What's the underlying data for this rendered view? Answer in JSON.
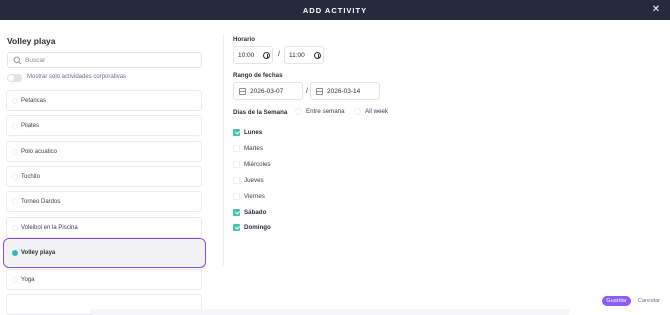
{
  "modal": {
    "title": "ADD ACTIVITY",
    "close_icon": "close-icon"
  },
  "left": {
    "heading": "Volley playa",
    "search": {
      "placeholder": "Buscar",
      "value": "",
      "icon": "search-icon"
    },
    "toggle": {
      "label": "Mostrar solo actividades corporativas",
      "on": false
    },
    "activities": [
      {
        "label": "Petancas",
        "selected": false
      },
      {
        "label": "Pilates",
        "selected": false
      },
      {
        "label": "Polo acuatico",
        "selected": false
      },
      {
        "label": "Tochito",
        "selected": false
      },
      {
        "label": "Torneo Dardos",
        "selected": false
      },
      {
        "label": "Voleibol en la Piscina",
        "selected": false
      },
      {
        "label": "Volley playa",
        "selected": true
      },
      {
        "label": "Yoga",
        "selected": false
      }
    ]
  },
  "right": {
    "horario": {
      "label": "Horario",
      "start": "10:00",
      "end": "11:00",
      "separator": "/",
      "icon": "clock-icon"
    },
    "fechas": {
      "label": "Rango de fechas",
      "start": "2026-03-07",
      "end": "2026-03-14",
      "separator": "/",
      "icon": "calendar-icon"
    },
    "dias": {
      "label": "Días de la Semana",
      "options": [
        {
          "label": "Entre semana",
          "selected": false
        },
        {
          "label": "All week",
          "selected": false
        }
      ],
      "days": [
        {
          "label": "Lunes",
          "checked": true
        },
        {
          "label": "Martes",
          "checked": false
        },
        {
          "label": "Miércoles",
          "checked": false
        },
        {
          "label": "Jueves",
          "checked": false
        },
        {
          "label": "Viernes",
          "checked": false
        },
        {
          "label": "Sábado",
          "checked": true
        },
        {
          "label": "Domingo",
          "checked": true
        }
      ]
    }
  },
  "footer": {
    "save_label": "Guardar",
    "cancel_label": "Cancelar"
  },
  "colors": {
    "header_bg": "#262a3d",
    "accent_purple": "#8d5cf0",
    "selected_border": "#8a4fd6",
    "check_teal": "#45c5b0",
    "radio_selected": "#39b3c6"
  }
}
